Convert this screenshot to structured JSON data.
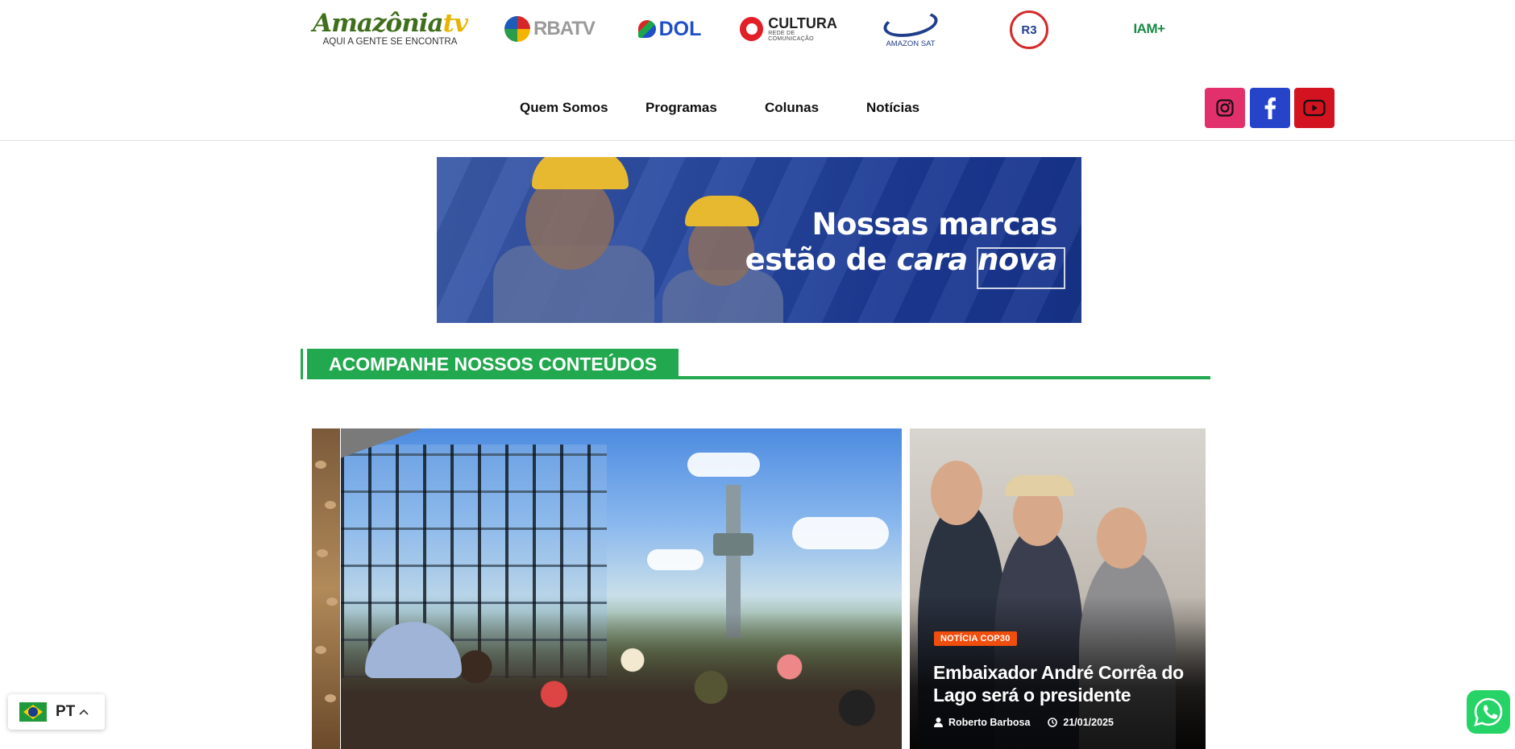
{
  "brands": {
    "amazonia": {
      "name_main": "Amazônia",
      "name_tv": "tv",
      "tagline": "AQUI A GENTE SE ENCONTRA"
    },
    "rbatv": {
      "name": "RBATV"
    },
    "dol": {
      "name": "DOL"
    },
    "cultura": {
      "name": "CULTURA",
      "subtitle": "REDE DE COMUNICAÇÃO"
    },
    "amazonsat": {
      "name": "AMAZON SAT"
    },
    "r3": {
      "name": "R3"
    },
    "iam": {
      "name": "IAM+"
    }
  },
  "nav": {
    "items": [
      {
        "label": "Quem Somos"
      },
      {
        "label": "Programas"
      },
      {
        "label": "Colunas"
      },
      {
        "label": "Notícias"
      }
    ]
  },
  "social": [
    {
      "icon": "instagram-icon",
      "color": "#e1306c"
    },
    {
      "icon": "facebook-icon",
      "color": "#2544c9"
    },
    {
      "icon": "youtube-icon",
      "color": "#d31320"
    }
  ],
  "banner": {
    "line1": "Nossas marcas",
    "line2_prefix": "estão de ",
    "line2_italic": "cara",
    "line2_suffix": " nova"
  },
  "section": {
    "title": "ACOMPANHE NOSSOS CONTEÚDOS",
    "accent": "#22a84e"
  },
  "featured": {
    "badge": "NOTÍCIA COP30",
    "badge_color": "#f04e0d",
    "title": "Embaixador André Corrêa do Lago será o presidente",
    "author": "Roberto Barbosa",
    "date": "21/01/2025"
  },
  "language": {
    "code": "PT",
    "flag": "brazil-flag-icon"
  },
  "whatsapp": {
    "icon": "whatsapp-icon",
    "color": "#25d366"
  }
}
